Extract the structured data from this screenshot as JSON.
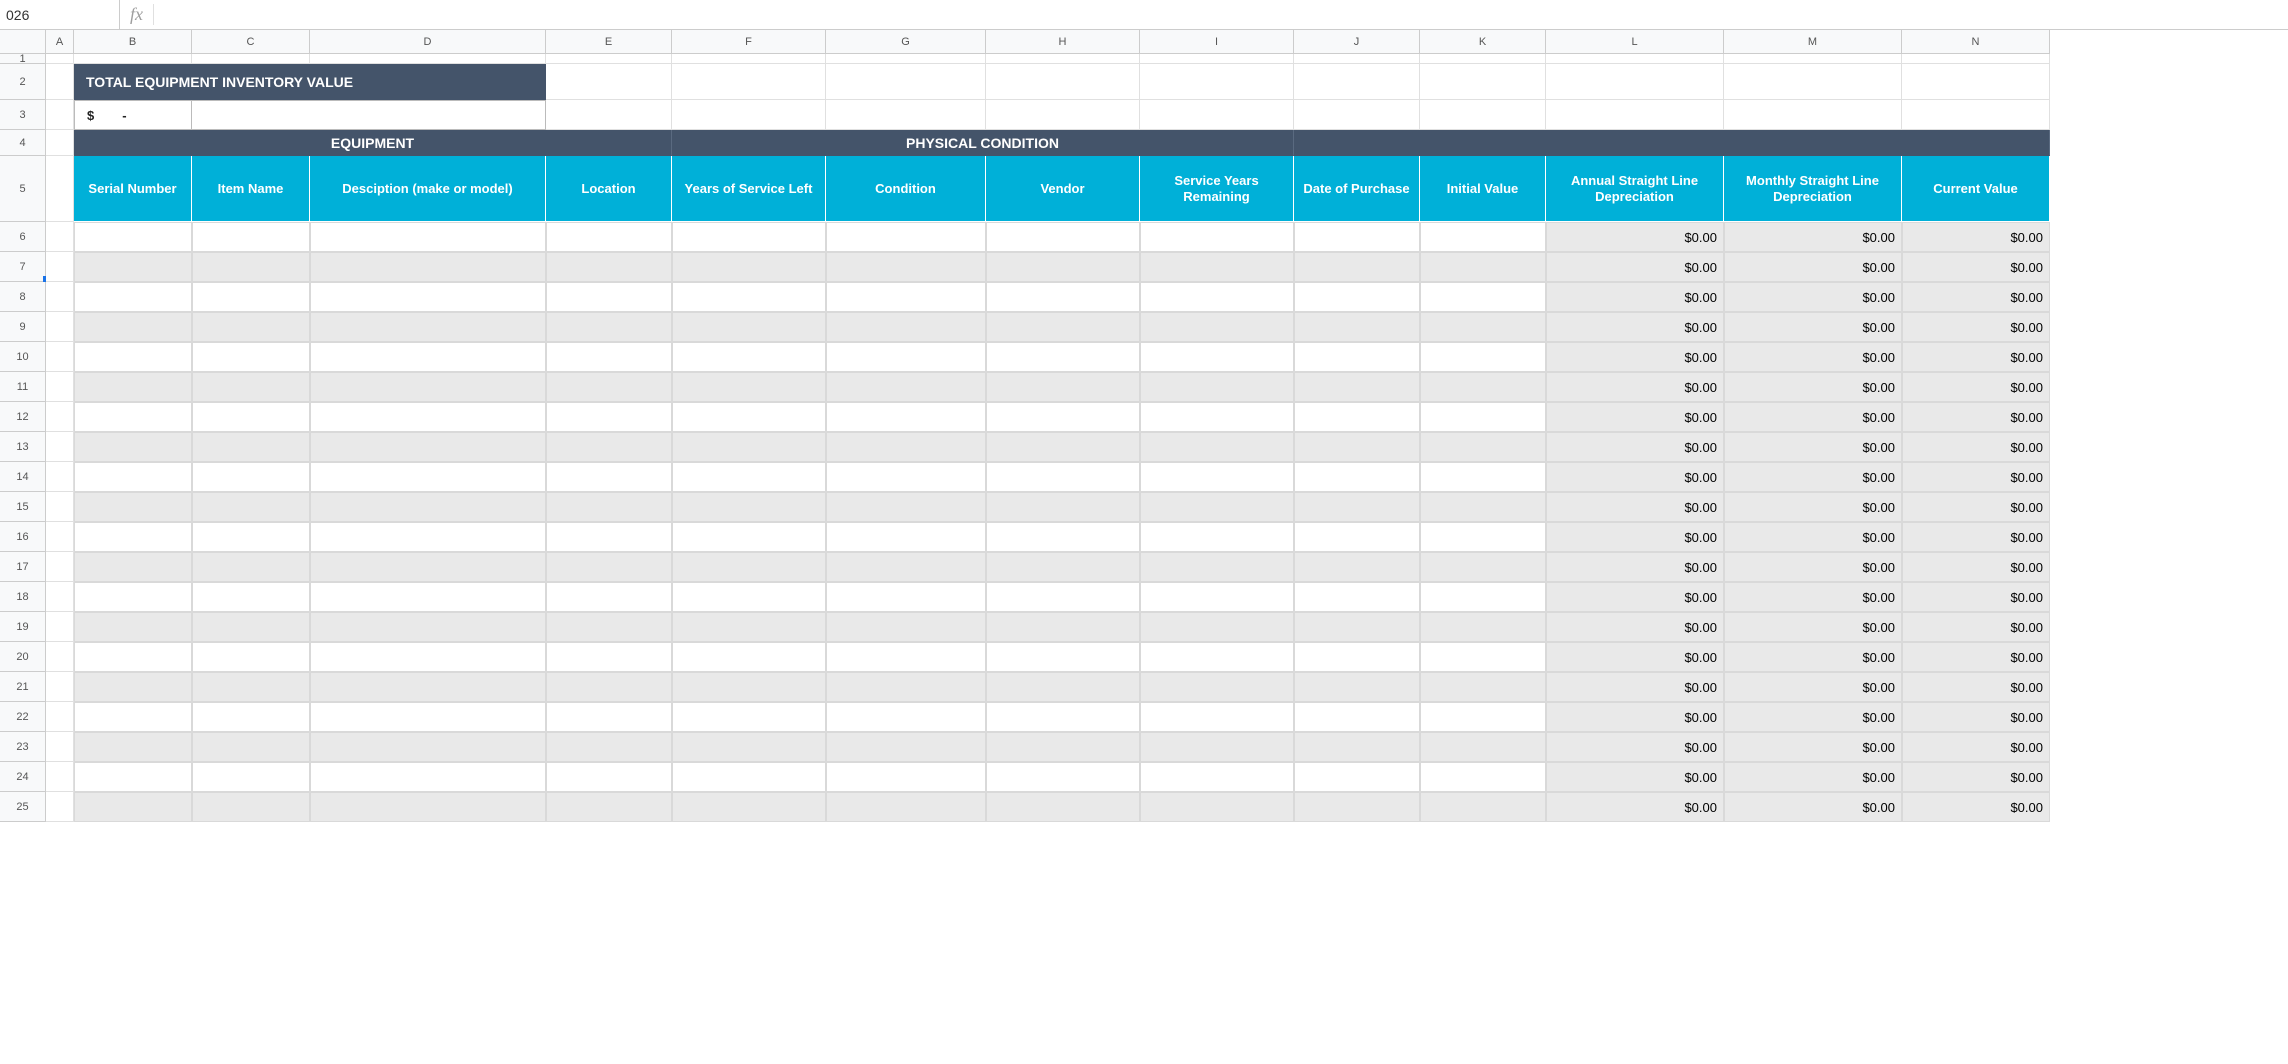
{
  "formula_bar": {
    "name_box": "026",
    "fx": "fx",
    "formula": ""
  },
  "columns": {
    "letters": [
      "A",
      "B",
      "C",
      "D",
      "E",
      "F",
      "G",
      "H",
      "I",
      "J",
      "K",
      "L",
      "M",
      "N"
    ],
    "widths": [
      28,
      118,
      118,
      236,
      126,
      154,
      160,
      154,
      154,
      126,
      126,
      178,
      178,
      148
    ]
  },
  "rows": {
    "numbers": [
      1,
      2,
      3,
      4,
      5,
      6,
      7,
      8,
      9,
      10,
      11,
      12,
      13,
      14,
      15,
      16,
      17,
      18,
      19,
      20,
      21,
      22,
      23,
      24,
      25
    ],
    "heights": [
      10,
      36,
      30,
      26,
      66,
      30,
      30,
      30,
      30,
      30,
      30,
      30,
      30,
      30,
      30,
      30,
      30,
      30,
      30,
      30,
      30,
      30,
      30,
      30,
      30
    ]
  },
  "template": {
    "title": "TOTAL EQUIPMENT INVENTORY VALUE",
    "total_value_symbol": "$",
    "total_value_dash": "-",
    "sections": {
      "equipment": "EQUIPMENT",
      "physical": "PHYSICAL CONDITION",
      "blank": ""
    },
    "col_headers": [
      "Serial Number",
      "Item Name",
      "Desciption (make or model)",
      "Location",
      "Years of Service Left",
      "Condition",
      "Vendor",
      "Service Years Remaining",
      "Date of Purchase",
      "Initial Value",
      "Annual Straight Line Depreciation",
      "Monthly Straight Line Depreciation",
      "Current Value"
    ],
    "zero": "$0.00",
    "data_row_count": 20
  }
}
